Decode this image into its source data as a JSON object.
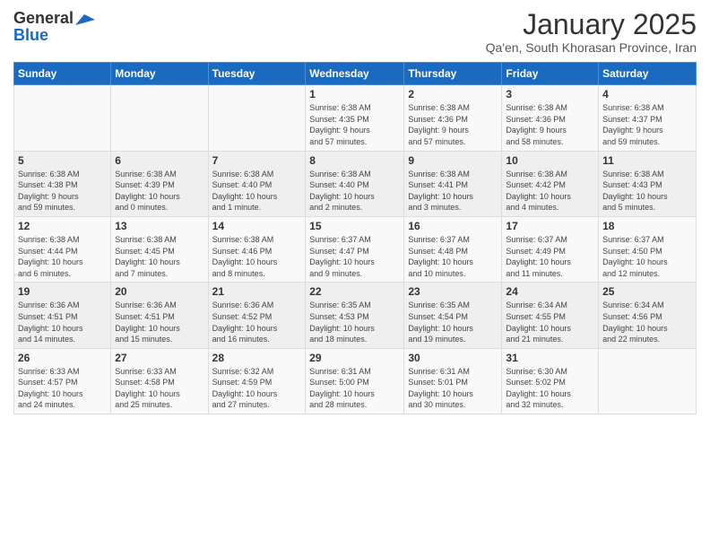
{
  "header": {
    "logo_general": "General",
    "logo_blue": "Blue",
    "title": "January 2025",
    "location": "Qa'en, South Khorasan Province, Iran"
  },
  "weekdays": [
    "Sunday",
    "Monday",
    "Tuesday",
    "Wednesday",
    "Thursday",
    "Friday",
    "Saturday"
  ],
  "weeks": [
    [
      {
        "day": "",
        "info": ""
      },
      {
        "day": "",
        "info": ""
      },
      {
        "day": "",
        "info": ""
      },
      {
        "day": "1",
        "info": "Sunrise: 6:38 AM\nSunset: 4:35 PM\nDaylight: 9 hours\nand 57 minutes."
      },
      {
        "day": "2",
        "info": "Sunrise: 6:38 AM\nSunset: 4:36 PM\nDaylight: 9 hours\nand 57 minutes."
      },
      {
        "day": "3",
        "info": "Sunrise: 6:38 AM\nSunset: 4:36 PM\nDaylight: 9 hours\nand 58 minutes."
      },
      {
        "day": "4",
        "info": "Sunrise: 6:38 AM\nSunset: 4:37 PM\nDaylight: 9 hours\nand 59 minutes."
      }
    ],
    [
      {
        "day": "5",
        "info": "Sunrise: 6:38 AM\nSunset: 4:38 PM\nDaylight: 9 hours\nand 59 minutes."
      },
      {
        "day": "6",
        "info": "Sunrise: 6:38 AM\nSunset: 4:39 PM\nDaylight: 10 hours\nand 0 minutes."
      },
      {
        "day": "7",
        "info": "Sunrise: 6:38 AM\nSunset: 4:40 PM\nDaylight: 10 hours\nand 1 minute."
      },
      {
        "day": "8",
        "info": "Sunrise: 6:38 AM\nSunset: 4:40 PM\nDaylight: 10 hours\nand 2 minutes."
      },
      {
        "day": "9",
        "info": "Sunrise: 6:38 AM\nSunset: 4:41 PM\nDaylight: 10 hours\nand 3 minutes."
      },
      {
        "day": "10",
        "info": "Sunrise: 6:38 AM\nSunset: 4:42 PM\nDaylight: 10 hours\nand 4 minutes."
      },
      {
        "day": "11",
        "info": "Sunrise: 6:38 AM\nSunset: 4:43 PM\nDaylight: 10 hours\nand 5 minutes."
      }
    ],
    [
      {
        "day": "12",
        "info": "Sunrise: 6:38 AM\nSunset: 4:44 PM\nDaylight: 10 hours\nand 6 minutes."
      },
      {
        "day": "13",
        "info": "Sunrise: 6:38 AM\nSunset: 4:45 PM\nDaylight: 10 hours\nand 7 minutes."
      },
      {
        "day": "14",
        "info": "Sunrise: 6:38 AM\nSunset: 4:46 PM\nDaylight: 10 hours\nand 8 minutes."
      },
      {
        "day": "15",
        "info": "Sunrise: 6:37 AM\nSunset: 4:47 PM\nDaylight: 10 hours\nand 9 minutes."
      },
      {
        "day": "16",
        "info": "Sunrise: 6:37 AM\nSunset: 4:48 PM\nDaylight: 10 hours\nand 10 minutes."
      },
      {
        "day": "17",
        "info": "Sunrise: 6:37 AM\nSunset: 4:49 PM\nDaylight: 10 hours\nand 11 minutes."
      },
      {
        "day": "18",
        "info": "Sunrise: 6:37 AM\nSunset: 4:50 PM\nDaylight: 10 hours\nand 12 minutes."
      }
    ],
    [
      {
        "day": "19",
        "info": "Sunrise: 6:36 AM\nSunset: 4:51 PM\nDaylight: 10 hours\nand 14 minutes."
      },
      {
        "day": "20",
        "info": "Sunrise: 6:36 AM\nSunset: 4:51 PM\nDaylight: 10 hours\nand 15 minutes."
      },
      {
        "day": "21",
        "info": "Sunrise: 6:36 AM\nSunset: 4:52 PM\nDaylight: 10 hours\nand 16 minutes."
      },
      {
        "day": "22",
        "info": "Sunrise: 6:35 AM\nSunset: 4:53 PM\nDaylight: 10 hours\nand 18 minutes."
      },
      {
        "day": "23",
        "info": "Sunrise: 6:35 AM\nSunset: 4:54 PM\nDaylight: 10 hours\nand 19 minutes."
      },
      {
        "day": "24",
        "info": "Sunrise: 6:34 AM\nSunset: 4:55 PM\nDaylight: 10 hours\nand 21 minutes."
      },
      {
        "day": "25",
        "info": "Sunrise: 6:34 AM\nSunset: 4:56 PM\nDaylight: 10 hours\nand 22 minutes."
      }
    ],
    [
      {
        "day": "26",
        "info": "Sunrise: 6:33 AM\nSunset: 4:57 PM\nDaylight: 10 hours\nand 24 minutes."
      },
      {
        "day": "27",
        "info": "Sunrise: 6:33 AM\nSunset: 4:58 PM\nDaylight: 10 hours\nand 25 minutes."
      },
      {
        "day": "28",
        "info": "Sunrise: 6:32 AM\nSunset: 4:59 PM\nDaylight: 10 hours\nand 27 minutes."
      },
      {
        "day": "29",
        "info": "Sunrise: 6:31 AM\nSunset: 5:00 PM\nDaylight: 10 hours\nand 28 minutes."
      },
      {
        "day": "30",
        "info": "Sunrise: 6:31 AM\nSunset: 5:01 PM\nDaylight: 10 hours\nand 30 minutes."
      },
      {
        "day": "31",
        "info": "Sunrise: 6:30 AM\nSunset: 5:02 PM\nDaylight: 10 hours\nand 32 minutes."
      },
      {
        "day": "",
        "info": ""
      }
    ]
  ]
}
